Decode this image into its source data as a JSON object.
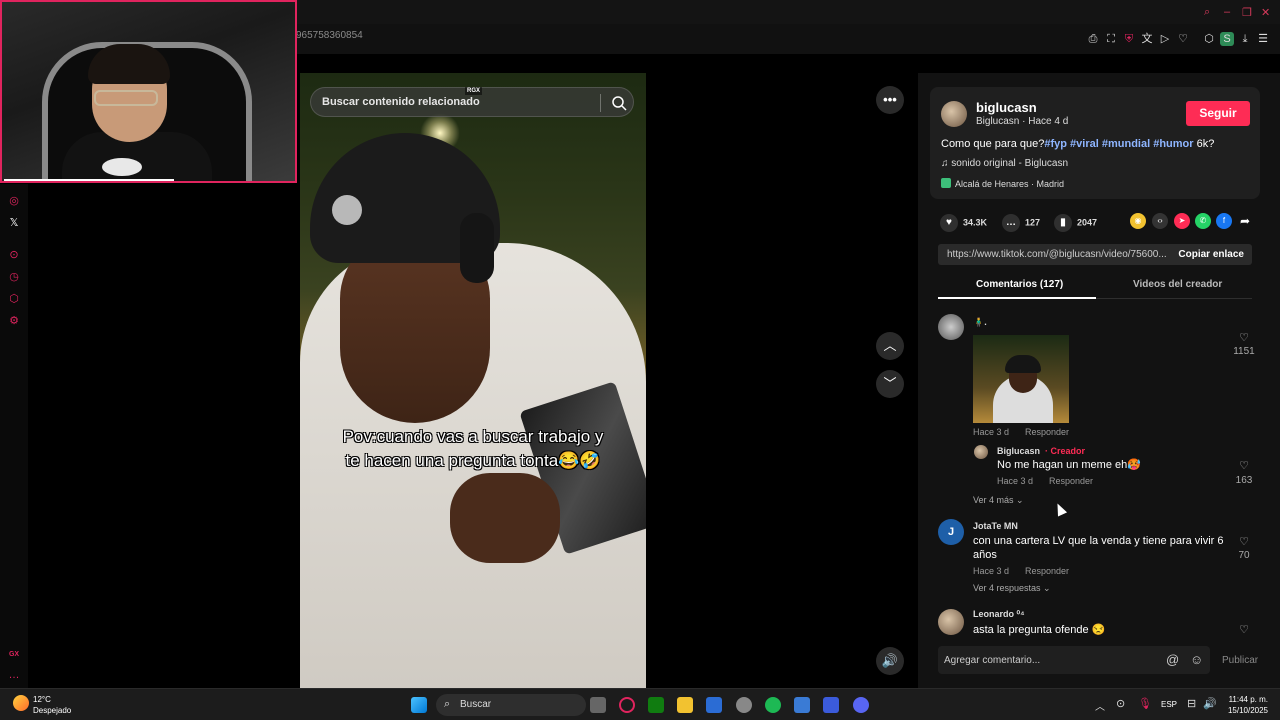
{
  "browser": {
    "address_fragment": "965758360854"
  },
  "video": {
    "search_placeholder": "Buscar contenido relacionado",
    "rgx_badge": "RGX",
    "caption": "Pov:cuando vas a buscar trabajo y te hacen una pregunta tonta😂🤣"
  },
  "post": {
    "username": "biglucasn",
    "subline": "Biglucasn · Hace 4 d",
    "follow_label": "Seguir",
    "desc_text": "Como que para que?",
    "hashtags": [
      "#fyp",
      "#viral",
      "#mundial",
      "#humor"
    ],
    "desc_tail": "6k?",
    "music": "sonido original - Biglucasn",
    "location": "Alcalá de Henares · Madrid",
    "likes": "34.3K",
    "comments": "127",
    "saves": "2047",
    "link": "https://www.tiktok.com/@biglucasn/video/75600...",
    "copy_label": "Copiar enlace",
    "tab_comments": "Comentarios (127)",
    "tab_videos": "Videos del creador"
  },
  "comments": [
    {
      "name": "🧍‍♂️.",
      "meta": "Hace 3 d",
      "reply": "Responder",
      "likes": "1151",
      "reply_item": {
        "name": "Biglucasn",
        "creator": "· Creador",
        "text": "No me hagan un meme eh🥵",
        "meta": "Hace 3 d",
        "reply": "Responder",
        "likes": "163"
      },
      "more": "Ver 4 más"
    },
    {
      "name": "JotaTe MN",
      "initial": "J",
      "text": "con una cartera LV que la venda y tiene para vivir 6 años",
      "meta": "Hace 3 d",
      "reply": "Responder",
      "likes": "70",
      "more": "Ver 4 respuestas"
    },
    {
      "name": "Leonardo ⁰⁴",
      "text": "asta la pregunta ofende 😒"
    }
  ],
  "composer": {
    "placeholder": "Agregar comentario...",
    "publish": "Publicar"
  },
  "taskbar": {
    "temp": "12°C",
    "weather": "Despejado",
    "search": "Buscar",
    "lang": "ESP",
    "time": "11:44 p. m.",
    "date": "15/10/2025"
  },
  "sidebar": {
    "gx_label": "GX"
  },
  "colors": {
    "accent": "#fe2c55",
    "gx": "#e0245e",
    "hashtag": "#8eb5ff"
  }
}
